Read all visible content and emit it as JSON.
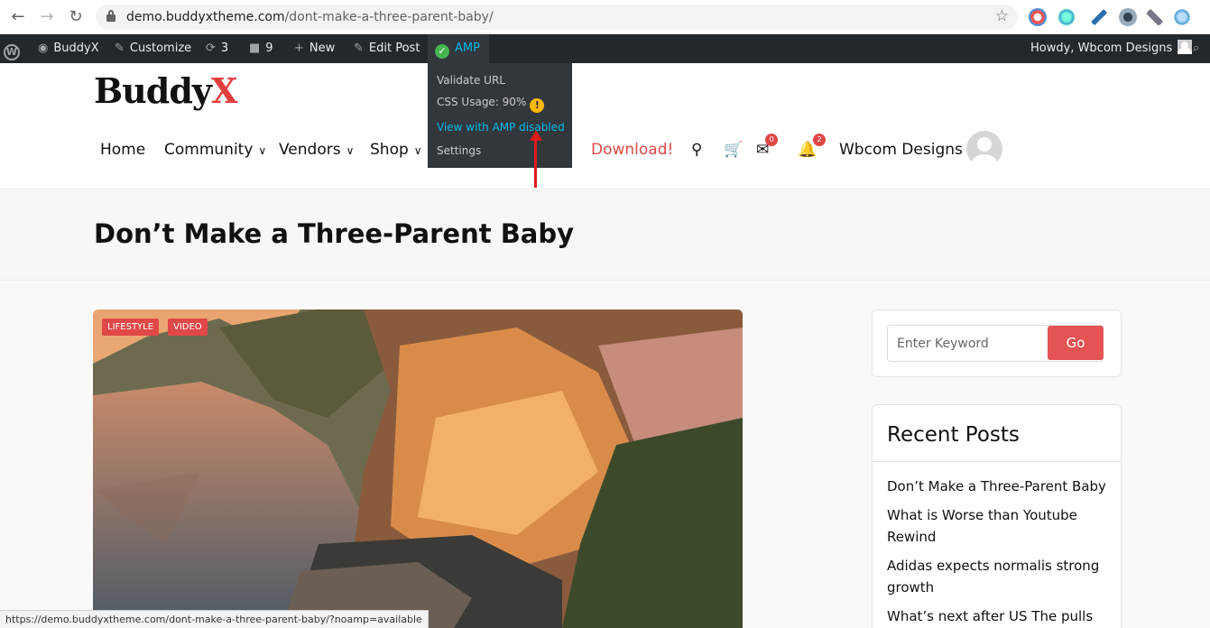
{
  "browser": {
    "url_domain": "demo.buddyxtheme.com",
    "url_path": "/dont-make-a-three-parent-baby/",
    "back_icon": "arrow-left",
    "forward_icon": "arrow-right",
    "reload_icon": "reload",
    "star_icon": "star"
  },
  "admin_bar": {
    "wp_logo": "W",
    "site": "BuddyX",
    "customize": "Customize",
    "updates": "3",
    "comments": "9",
    "new": "New",
    "edit_post": "Edit Post",
    "amp": "AMP",
    "howdy": "Howdy, Wbcom Designs"
  },
  "amp_menu": {
    "validate": "Validate URL",
    "css_usage": "CSS Usage: 90%",
    "view_disabled": "View with AMP disabled",
    "settings": "Settings"
  },
  "header": {
    "logo_main": "Buddy",
    "logo_accent": "X",
    "nav": {
      "home": "Home",
      "community": "Community",
      "vendors": "Vendors",
      "shop": "Shop",
      "download": "Download!"
    },
    "messages_count": "0",
    "notifications_count": "2",
    "user_name": "Wbcom Designs"
  },
  "page": {
    "title": "Don’t Make a Three-Parent Baby",
    "categories": [
      "LIFESTYLE",
      "VIDEO"
    ]
  },
  "sidebar": {
    "search_placeholder": "Enter Keyword",
    "search_button": "Go",
    "recent_title": "Recent Posts",
    "recent_posts": [
      "Don’t Make a Three-Parent Baby",
      "What is Worse than Youtube Rewind",
      "Adidas expects normalis strong growth",
      "What’s next after US The pulls out"
    ]
  },
  "status_url": "https://demo.buddyxtheme.com/dont-make-a-three-parent-baby/?noamp=available",
  "colors": {
    "accent": "#e04848",
    "admin_bar": "#23282d",
    "amp_link": "#00b9eb",
    "arrow": "#e01b1b"
  }
}
